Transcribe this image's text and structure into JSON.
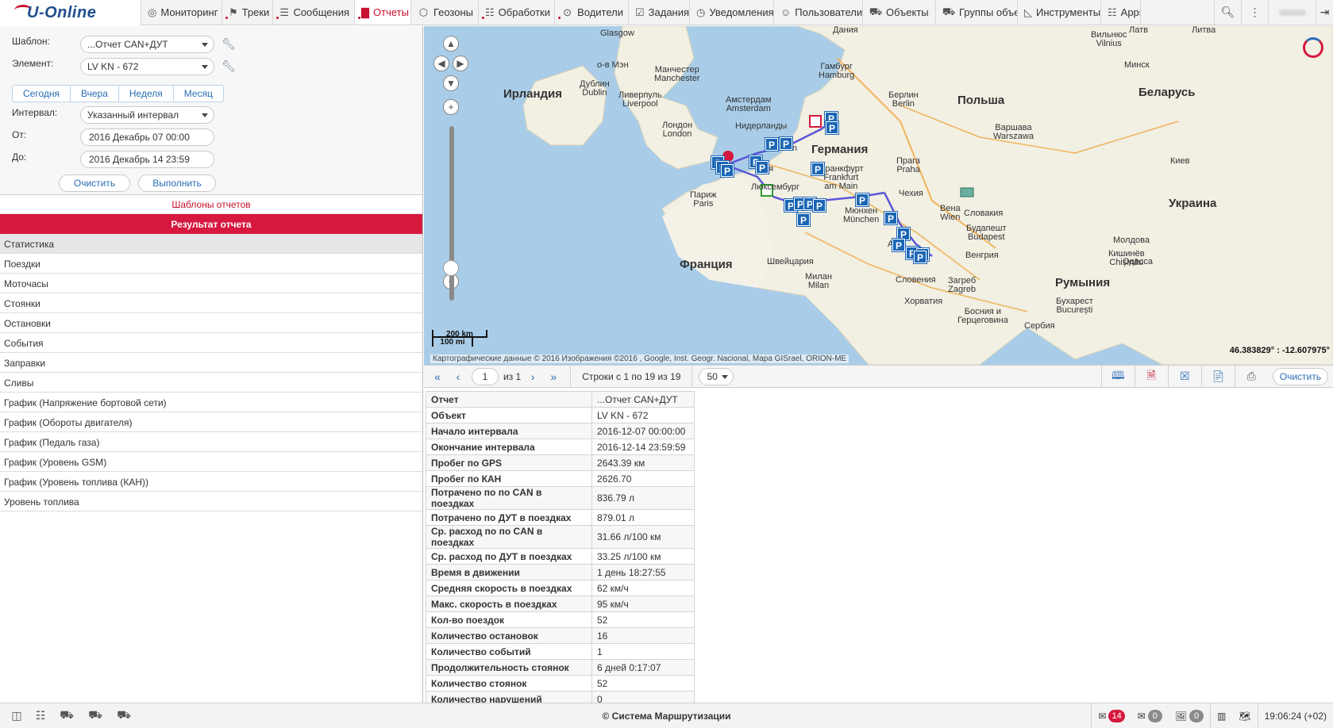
{
  "app": {
    "logo": "U-Online"
  },
  "nav": {
    "items": [
      {
        "label": "Мониторинг",
        "icon": "globe-icon"
      },
      {
        "label": "Треки",
        "icon": "flag-icon"
      },
      {
        "label": "Сообщения",
        "icon": "list-icon"
      },
      {
        "label": "Отчеты",
        "icon": "chart-icon"
      },
      {
        "label": "Геозоны",
        "icon": "geofence-icon"
      },
      {
        "label": "Обработки",
        "icon": "grid-icon"
      },
      {
        "label": "Водители",
        "icon": "steering-wheel-icon"
      },
      {
        "label": "Задания",
        "icon": "checkbox-icon"
      },
      {
        "label": "Уведомления",
        "icon": "clock-icon"
      },
      {
        "label": "Пользователи",
        "icon": "user-icon"
      },
      {
        "label": "Объекты",
        "icon": "car-icon"
      },
      {
        "label": "Группы объектов",
        "icon": "car-group-icon"
      },
      {
        "label": "Инструменты",
        "icon": "ruler-icon"
      },
      {
        "label": "Apps",
        "icon": "apps-icon"
      }
    ],
    "active": "Отчеты"
  },
  "form": {
    "template_label": "Шаблон:",
    "template_value": "...Отчет CAN+ДУТ",
    "element_label": "Элемент:",
    "element_value": "LV KN - 672",
    "periods": [
      "Сегодня",
      "Вчера",
      "Неделя",
      "Месяц"
    ],
    "interval_label": "Интервал:",
    "interval_value": "Указанный интервал",
    "from_label": "От:",
    "from_value": "2016 Декабрь 07 00:00",
    "to_label": "До:",
    "to_value": "2016 Декабрь 14 23:59",
    "clear_label": "Очистить",
    "run_label": "Выполнить"
  },
  "templates_link": "Шаблоны отчетов",
  "result_header": "Результат отчета",
  "result_list": [
    "Статистика",
    "Поездки",
    "Моточасы",
    "Стоянки",
    "Остановки",
    "События",
    "Заправки",
    "Сливы",
    "График (Напряжение бортовой сети)",
    "График (Обороты двигателя)",
    "График (Педаль газа)",
    "График (Уровень GSM)",
    "График (Уровень топлива (КАН))",
    "Уровень топлива"
  ],
  "map": {
    "labels": [
      {
        "t": "Glasgow"
      },
      {
        "t": "о-в Мэн"
      },
      {
        "t": "Манчестер\nManchester"
      },
      {
        "t": "Дублин\nDublin"
      },
      {
        "t": "Ирландия",
        "big": true
      },
      {
        "t": "Ливерпуль\nLiverpool"
      },
      {
        "t": "Лондон\nLondon"
      },
      {
        "t": "Амстердам\nAmsterdam"
      },
      {
        "t": "Нидерланды"
      },
      {
        "t": "Гамбург\nHamburg"
      },
      {
        "t": "Берлин\nBerlin"
      },
      {
        "t": "Германия",
        "big": true
      },
      {
        "t": "Польша",
        "big": true
      },
      {
        "t": "Варшава\nWarszawa"
      },
      {
        "t": "Вильнюс\nVilnius"
      },
      {
        "t": "Минск"
      },
      {
        "t": "Беларусь",
        "big": true
      },
      {
        "t": "Киев"
      },
      {
        "t": "Украина",
        "big": true
      },
      {
        "t": "Köln"
      },
      {
        "t": "Франкфурт\nFrankfurt\nam Main"
      },
      {
        "t": "Прага\nPraha"
      },
      {
        "t": "Чехия"
      },
      {
        "t": "Париж\nParis"
      },
      {
        "t": "Франция",
        "big": true
      },
      {
        "t": "Люксембург"
      },
      {
        "t": "Мюнхен\nMünchen"
      },
      {
        "t": "Вена\nWien"
      },
      {
        "t": "Словакия"
      },
      {
        "t": "Будапешт\nBudapest"
      },
      {
        "t": "Венгрия"
      },
      {
        "t": "Молдова"
      },
      {
        "t": "Кишинёв\nChișinău"
      },
      {
        "t": "Одесса"
      },
      {
        "t": "Румыния",
        "big": true
      },
      {
        "t": "Бухарест\nBucurești"
      },
      {
        "t": "Швейцария"
      },
      {
        "t": "Милан\nMilan"
      },
      {
        "t": "Словения"
      },
      {
        "t": "Загреб\nZagreb"
      },
      {
        "t": "Хорватия"
      },
      {
        "t": "Босния и\nГерцеговина"
      },
      {
        "t": "Сербия"
      },
      {
        "t": "Латв"
      },
      {
        "t": "Литва"
      },
      {
        "t": "Дания"
      },
      {
        "t": "Авс"
      },
      {
        "t": "ия"
      }
    ],
    "scale_km": "200 km",
    "scale_mi": "100 mi",
    "attribution": "Картографические данные © 2016 Изображения ©2016 , Google, Inst. Geogr. Nacional, Mapa GISrael, ORION-ME",
    "coordinates": "46.383829° : -12.607975°",
    "parking_symbol": "P"
  },
  "toolbar": {
    "page_value": "1",
    "of_label": "из 1",
    "rows_label": "Строки с 1 по 19 из 19",
    "per_page": "50",
    "clear_label": "Очистить"
  },
  "stats": [
    [
      "Отчет",
      "...Отчет CAN+ДУТ"
    ],
    [
      "Объект",
      "LV KN - 672"
    ],
    [
      "Начало интервала",
      "2016-12-07 00:00:00"
    ],
    [
      "Окончание интервала",
      "2016-12-14 23:59:59"
    ],
    [
      "Пробег по GPS",
      "2643.39 км"
    ],
    [
      "Пробег по КАН",
      "2626.70"
    ],
    [
      "Потрачено по по CAN в поездках",
      "836.79 л"
    ],
    [
      "Потрачено по ДУТ в поездках",
      "879.01 л"
    ],
    [
      "Ср. расход по по CAN в поездках",
      "31.66 л/100 км"
    ],
    [
      "Ср. расход по ДУТ в поездках",
      "33.25 л/100 км"
    ],
    [
      "Время в движении",
      "1 день 18:27:55"
    ],
    [
      "Средняя скорость в поездках",
      "62 км/ч"
    ],
    [
      "Макс. скорость в поездках",
      "95 км/ч"
    ],
    [
      "Кол-во поездок",
      "52"
    ],
    [
      "Количество остановок",
      "16"
    ],
    [
      "Количество событий",
      "1"
    ],
    [
      "Продолжительность стоянок",
      "6 дней 0:17:07"
    ],
    [
      "Количество стоянок",
      "52"
    ],
    [
      "Количество нарушений",
      "0"
    ]
  ],
  "status": {
    "copyright": "© Система Маршрутизации",
    "messages_count": "14",
    "mail_count": "0",
    "images_count": "0",
    "clock": "19:06:24 (+02)"
  }
}
